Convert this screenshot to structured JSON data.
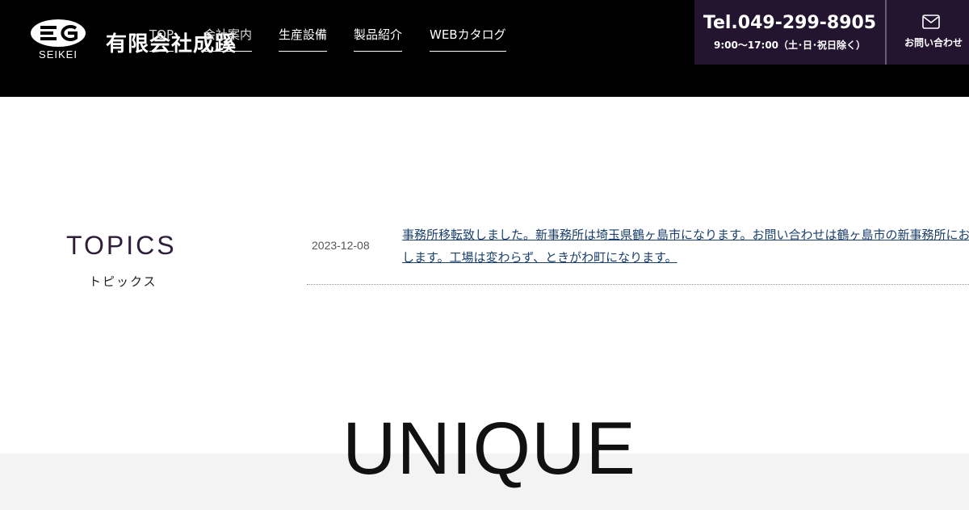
{
  "header": {
    "logo": {
      "mark": "EG",
      "sub": "SEIKEI"
    },
    "company_name": "有限会社成蹊",
    "nav": [
      {
        "label": "TOP"
      },
      {
        "label": "会社案内"
      },
      {
        "label": "生産設備"
      },
      {
        "label": "製品紹介"
      },
      {
        "label": "WEBカタログ"
      }
    ],
    "tel": {
      "number": "Tel.049-299-8905",
      "hours": "9:00〜17:00（土･日･祝日除く）"
    },
    "contact": {
      "label": "お問い合わせ",
      "icon": "mail-icon"
    }
  },
  "topics": {
    "title": "TOPICS",
    "subtitle": "トピックス",
    "items": [
      {
        "date": "2023-12-08",
        "text": "事務所移転致しました。新事務所は埼玉県鶴ヶ島市になります。お問い合わせは鶴ヶ島市の新事務所にお願い致します。工場は変わらず、ときがわ町になります。"
      }
    ]
  },
  "unique": {
    "title": "UNIQUE"
  },
  "colors": {
    "header_bg": "#000000",
    "accent": "#231530",
    "link": "#1a3f6b",
    "band": "#f3f3f3"
  }
}
